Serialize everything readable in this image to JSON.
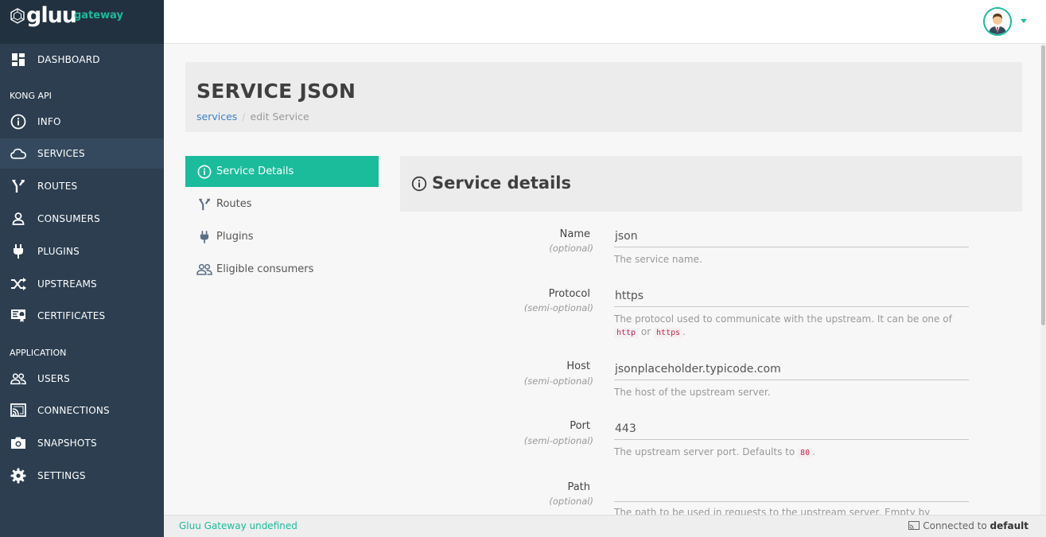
{
  "brand": {
    "name": "gluu",
    "sub": "gateway"
  },
  "sidebar": {
    "dashboard": "DASHBOARD",
    "section_kong": "KONG API",
    "kong_items": [
      {
        "label": "INFO",
        "icon": "info-icon"
      },
      {
        "label": "SERVICES",
        "icon": "cloud-icon"
      },
      {
        "label": "ROUTES",
        "icon": "fork-icon"
      },
      {
        "label": "CONSUMERS",
        "icon": "user-icon"
      },
      {
        "label": "PLUGINS",
        "icon": "plug-icon"
      },
      {
        "label": "UPSTREAMS",
        "icon": "shuffle-icon"
      },
      {
        "label": "CERTIFICATES",
        "icon": "certificate-icon"
      }
    ],
    "section_app": "APPLICATION",
    "app_items": [
      {
        "label": "USERS",
        "icon": "users-icon"
      },
      {
        "label": "CONNECTIONS",
        "icon": "cast-icon"
      },
      {
        "label": "SNAPSHOTS",
        "icon": "camera-icon"
      },
      {
        "label": "SETTINGS",
        "icon": "gear-icon"
      }
    ],
    "active": "SERVICES"
  },
  "header": {
    "title": "SERVICE JSON",
    "breadcrumb": {
      "link": "services",
      "separator": "/",
      "current": "edit Service"
    }
  },
  "tabs": [
    {
      "label": "Service Details",
      "icon": "info-icon",
      "active": true
    },
    {
      "label": "Routes",
      "icon": "fork-icon",
      "active": false
    },
    {
      "label": "Plugins",
      "icon": "plug-icon",
      "active": false
    },
    {
      "label": "Eligible consumers",
      "icon": "users-icon",
      "active": false
    }
  ],
  "card": {
    "title": "Service details"
  },
  "fields": [
    {
      "label": "Name",
      "sub": "(optional)",
      "value": "json",
      "help": "The service name."
    },
    {
      "label": "Protocol",
      "sub": "(semi-optional)",
      "value": "https",
      "help_pre": "The protocol used to communicate with the upstream. It can be one of",
      "help_code1": "http",
      "help_or": "or",
      "help_code2": "https",
      "help_post": "."
    },
    {
      "label": "Host",
      "sub": "(semi-optional)",
      "value": "jsonplaceholder.typicode.com",
      "help": "The host of the upstream server."
    },
    {
      "label": "Port",
      "sub": "(semi-optional)",
      "value": "443",
      "help_pre": "The upstream server port. Defaults to",
      "help_code1": "80",
      "help_post": "."
    },
    {
      "label": "Path",
      "sub": "(optional)",
      "value": "",
      "help": "The path to be used in requests to the upstream server. Empty by"
    }
  ],
  "footer": {
    "left": "Gluu Gateway undefined",
    "right_prefix": "Connected to",
    "right_target": "default"
  },
  "colors": {
    "accent": "#1abc9c",
    "sidebar": "#2c3e50",
    "sidebar_active": "#34495e",
    "link": "#3b7fc4"
  }
}
